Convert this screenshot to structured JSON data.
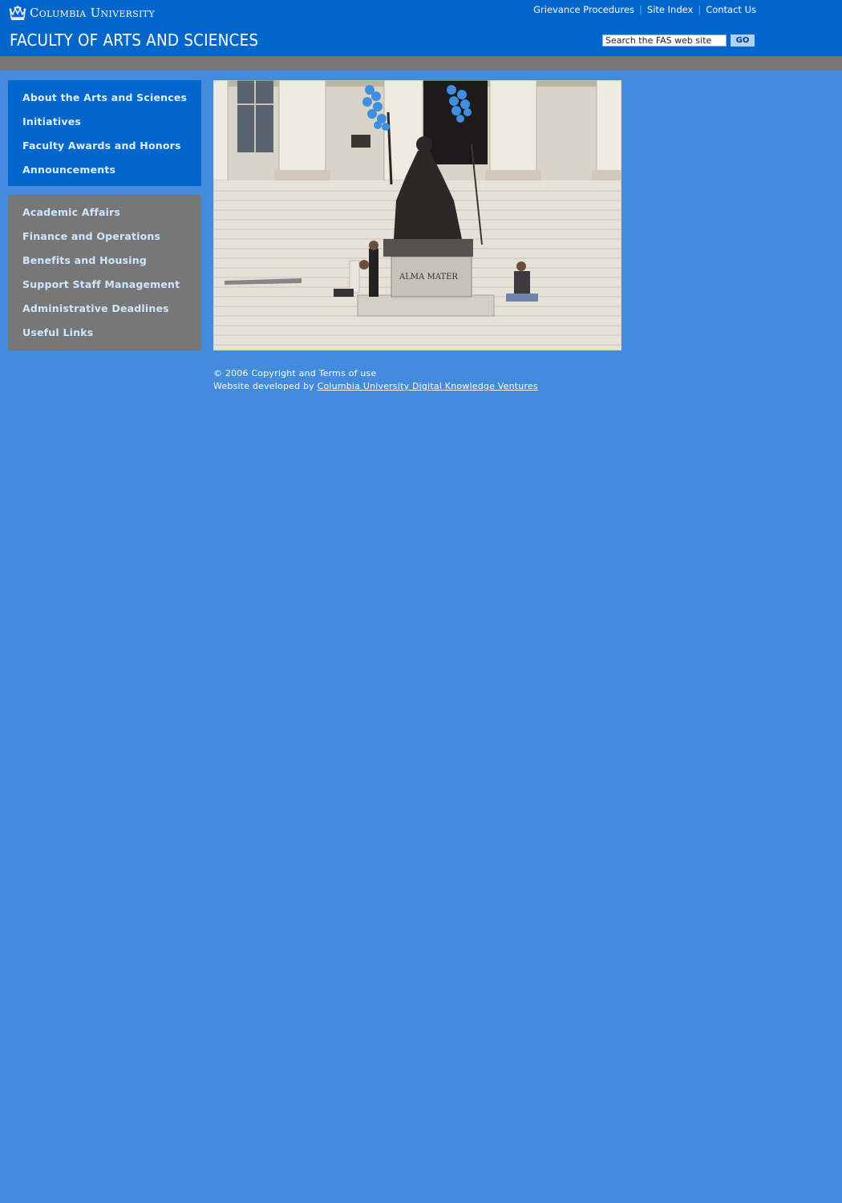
{
  "header": {
    "university": "Columbia University",
    "title": "FACULTY OF ARTS AND SCIENCES",
    "utility_links": [
      "Grievance Procedures",
      "Site Index",
      "Contact Us"
    ],
    "search": {
      "placeholder": "Search the FAS web site",
      "value": "Search the FAS web site"
    },
    "go_label": "GO"
  },
  "nav_primary": [
    "About the Arts and Sciences",
    "Initiatives",
    "Faculty Awards and Honors",
    "Announcements"
  ],
  "nav_secondary": [
    "Academic Affairs",
    "Finance and Operations",
    "Benefits and Housing",
    "Support Staff Management",
    "Administrative Deadlines",
    "Useful Links"
  ],
  "hero": {
    "statue_inscription": "ALMA MATER"
  },
  "footer": {
    "copyright": "© 2006 Copyright and Terms of use",
    "developed_prefix": "Website developed by",
    "developer_link": "Columbia University Digital Knowledge Ventures"
  },
  "colors": {
    "page_bg": "#428bde",
    "header_bg": "#0066cc",
    "gray_bar": "#777777",
    "go_button_bg": "#aed2f3"
  }
}
